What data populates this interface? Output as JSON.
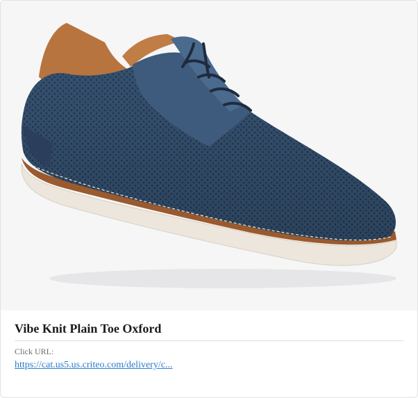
{
  "product": {
    "title": "Vibe Knit Plain Toe Oxford",
    "click_url_label": "Click URL:",
    "click_url": "https://cat.us5.us.criteo.com/delivery/c..."
  },
  "image": {
    "icon": "shoe-image",
    "colors": {
      "upper": "#2f4766",
      "leather_trim": "#b8743f",
      "sole": "#ece6dc",
      "welt": "#9a5a2e",
      "background": "#f6f6f7"
    }
  }
}
